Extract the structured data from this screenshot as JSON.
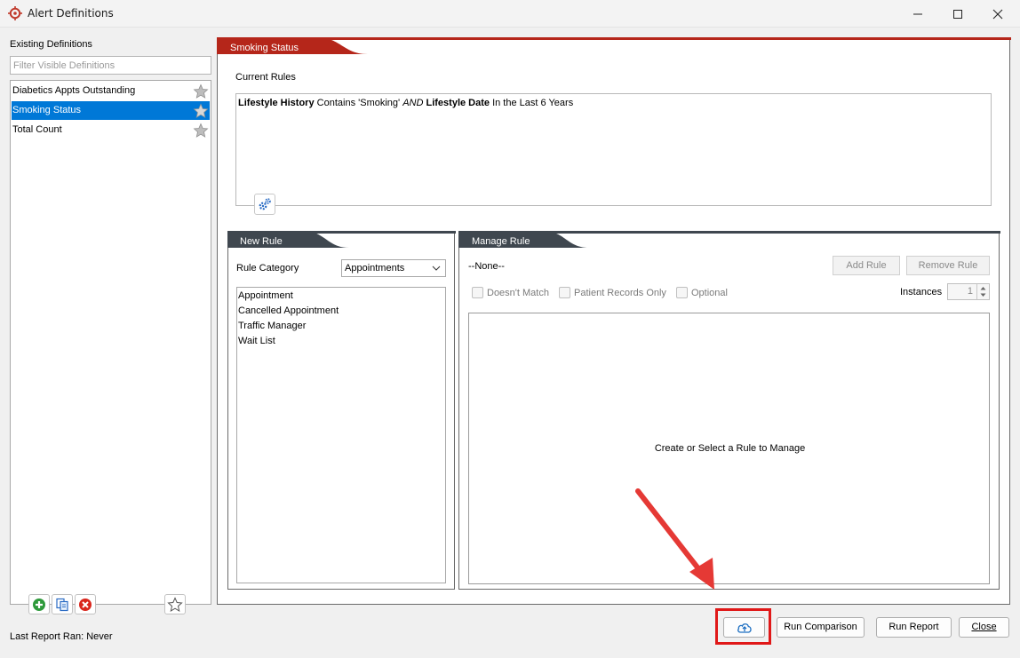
{
  "window": {
    "title": "Alert Definitions"
  },
  "left": {
    "existing_label": "Existing Definitions",
    "filter_placeholder": "Filter Visible Definitions",
    "definitions": [
      {
        "label": "Diabetics Appts Outstanding",
        "selected": false
      },
      {
        "label": "Smoking Status",
        "selected": true
      },
      {
        "label": "Total Count",
        "selected": false
      }
    ],
    "last_report": "Last Report Ran: Never"
  },
  "definition": {
    "tab_title": "Smoking Status",
    "current_rules_label": "Current Rules",
    "rule": {
      "field1": "Lifestyle History",
      "op1": "Contains 'Smoking'",
      "conj": "AND",
      "field2": "Lifestyle Date",
      "op2": "In the Last 6 Years"
    }
  },
  "new_rule": {
    "tab_title": "New Rule",
    "category_label": "Rule Category",
    "category_value": "Appointments",
    "items": [
      "Appointment",
      "Cancelled Appointment",
      "Traffic Manager",
      "Wait List"
    ]
  },
  "manage_rule": {
    "tab_title": "Manage Rule",
    "none_text": "--None--",
    "add_rule": "Add Rule",
    "remove_rule": "Remove Rule",
    "doesnt_match": "Doesn't Match",
    "patient_records_only": "Patient Records Only",
    "optional": "Optional",
    "instances_label": "Instances",
    "instances_value": "1",
    "empty_message": "Create or Select a Rule to Manage"
  },
  "buttons": {
    "run_comparison": "Run Comparison",
    "run_report": "Run Report",
    "close": "Close"
  },
  "colors": {
    "accent_red": "#b5261a",
    "dark_tab": "#3f474f",
    "selection": "#0078d7",
    "annotation_red": "#e01818"
  }
}
